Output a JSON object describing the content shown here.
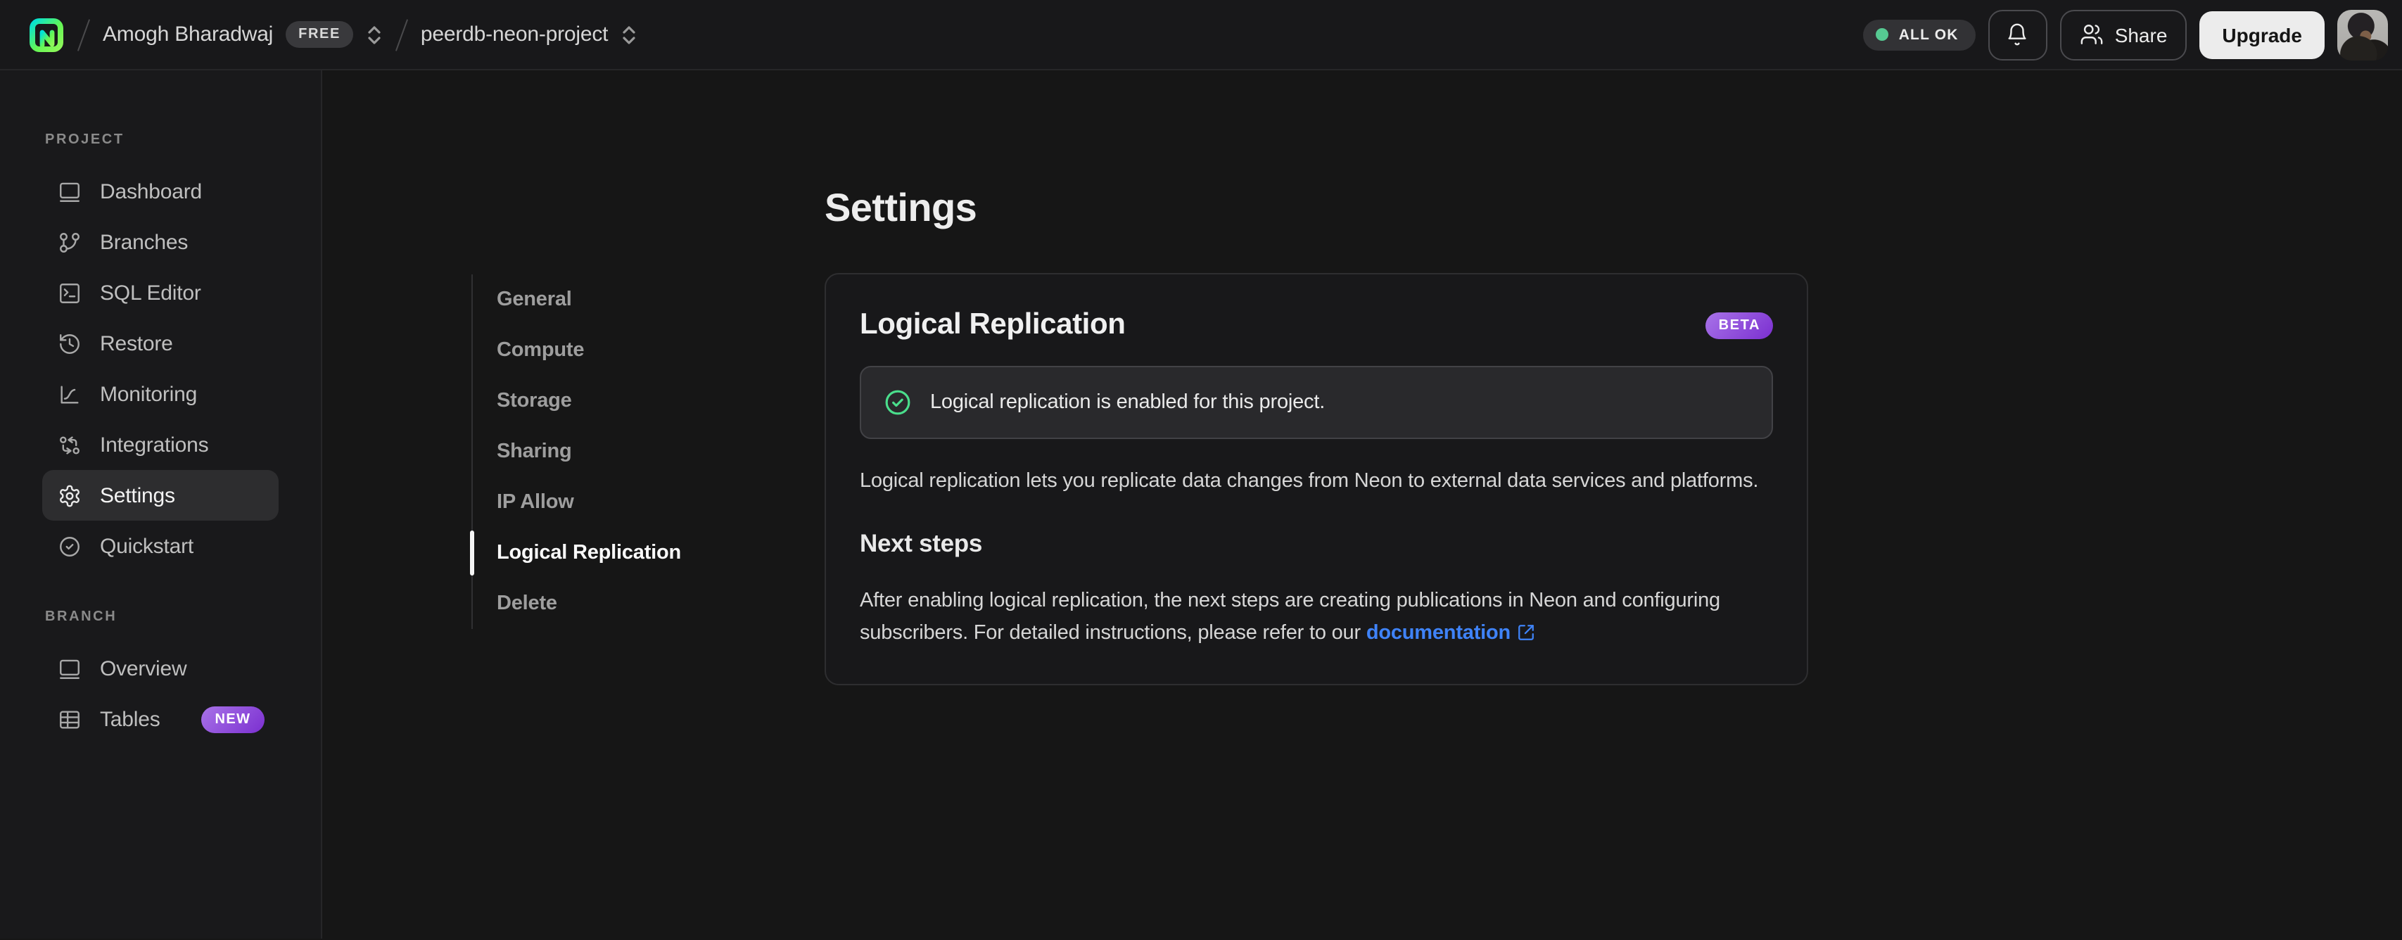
{
  "header": {
    "org_name": "Amogh Bharadwaj",
    "plan_badge": "FREE",
    "project_name": "peerdb-neon-project",
    "status_badge": "ALL OK",
    "share_label": "Share",
    "upgrade_label": "Upgrade",
    "icons": [
      "neon-logo",
      "bell-icon",
      "users-icon",
      "avatar"
    ]
  },
  "sidebar": {
    "project_section_label": "PROJECT",
    "project_items": [
      {
        "label": "Dashboard",
        "icon": "dashboard-icon",
        "active": false
      },
      {
        "label": "Branches",
        "icon": "git-branch-icon",
        "active": false
      },
      {
        "label": "SQL Editor",
        "icon": "terminal-icon",
        "active": false
      },
      {
        "label": "Restore",
        "icon": "history-icon",
        "active": false
      },
      {
        "label": "Monitoring",
        "icon": "chart-icon",
        "active": false
      },
      {
        "label": "Integrations",
        "icon": "integrations-icon",
        "active": false
      },
      {
        "label": "Settings",
        "icon": "gear-icon",
        "active": true
      },
      {
        "label": "Quickstart",
        "icon": "check-circle-icon",
        "active": false
      }
    ],
    "branch_section_label": "BRANCH",
    "branch_items": [
      {
        "label": "Overview",
        "icon": "window-icon",
        "badge": ""
      },
      {
        "label": "Tables",
        "icon": "table-icon",
        "badge": "NEW"
      }
    ]
  },
  "settings_nav": {
    "items": [
      {
        "label": "General",
        "active": false
      },
      {
        "label": "Compute",
        "active": false
      },
      {
        "label": "Storage",
        "active": false
      },
      {
        "label": "Sharing",
        "active": false
      },
      {
        "label": "IP Allow",
        "active": false
      },
      {
        "label": "Logical Replication",
        "active": true
      },
      {
        "label": "Delete",
        "active": false
      }
    ]
  },
  "main": {
    "page_title": "Settings",
    "card": {
      "title": "Logical Replication",
      "beta_badge": "BETA",
      "alert_text": "Logical replication is enabled for this project.",
      "alert_icon": "check-circle-icon",
      "description": "Logical replication lets you replicate data changes from Neon to external data services and platforms.",
      "next_steps_title": "Next steps",
      "next_steps_text": "After enabling logical replication, the next steps are creating publications in Neon and configuring subscribers. For detailed instructions, please refer to our ",
      "link_label": "documentation",
      "link_icon": "external-link-icon"
    }
  },
  "colors": {
    "brand_green": "#63f655",
    "brand_teal": "#00e0d9",
    "status_green": "#56c992",
    "badge_purple_light": "#a873e8",
    "badge_purple_dark": "#7b2fd0",
    "link_blue": "#3f83f8",
    "background": "#161616"
  }
}
